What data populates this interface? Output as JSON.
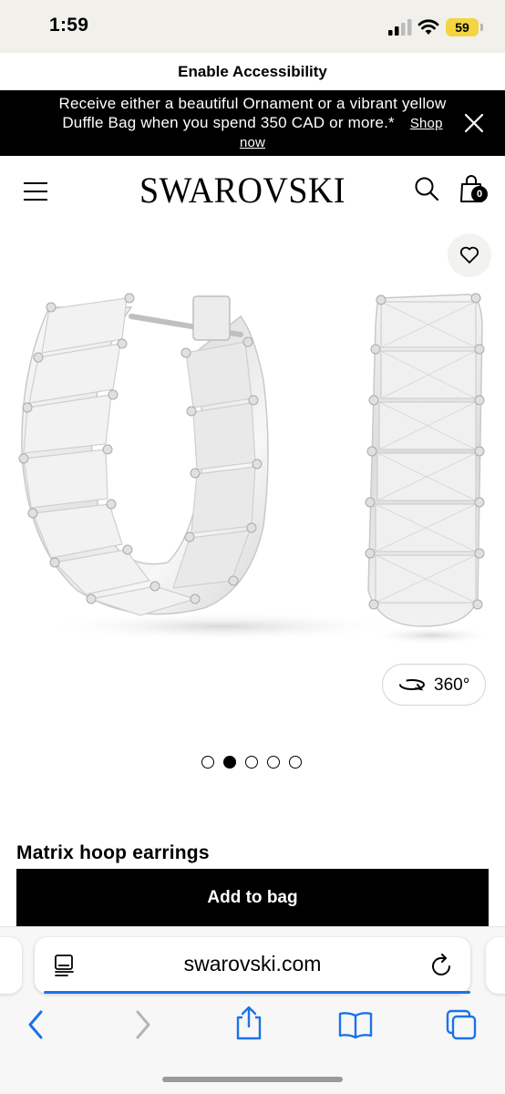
{
  "status_bar": {
    "time": "1:59",
    "battery": "59",
    "colors": {
      "battery": "#f4d541"
    }
  },
  "accessibility": {
    "label": "Enable Accessibility"
  },
  "promo": {
    "text": "Receive either a beautiful Ornament or a vibrant yellow Duffle Bag when you spend 350 CAD or more.*",
    "link": "Shop now"
  },
  "header": {
    "logo": "SWAROVSKI",
    "bag_count": "0"
  },
  "product": {
    "view_360_label": "360°",
    "carousel": {
      "total": 5,
      "active_index": 1
    },
    "title": "Matrix hoop earrings",
    "add_to_bag": "Add to bag"
  },
  "browser": {
    "url": "swarovski.com",
    "accent_color": "#1a73e8"
  }
}
